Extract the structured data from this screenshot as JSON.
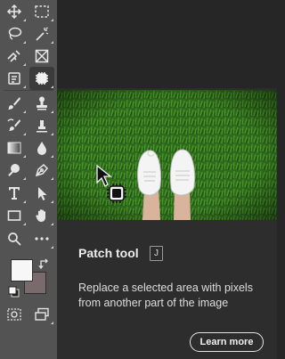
{
  "toolbar": {
    "tools": [
      {
        "name": "move-tool",
        "icon": "move-icon"
      },
      {
        "name": "rectangular-marquee-tool",
        "icon": "marquee-icon"
      },
      {
        "name": "lasso-tool",
        "icon": "lasso-icon"
      },
      {
        "name": "magic-wand-tool",
        "icon": "magic-wand-icon"
      },
      {
        "name": "crop-tool",
        "icon": "crop-icon"
      },
      {
        "name": "frame-tool",
        "icon": "frame-icon"
      },
      {
        "name": "eyedropper-tool",
        "icon": "eyedropper-icon"
      },
      {
        "name": "patch-tool",
        "icon": "patch-icon",
        "active": true
      },
      {
        "name": "brush-tool",
        "icon": "brush-icon"
      },
      {
        "name": "clone-stamp-tool",
        "icon": "stamp-icon"
      },
      {
        "name": "history-brush-tool",
        "icon": "history-brush-icon"
      },
      {
        "name": "eraser-tool",
        "icon": "eraser-icon"
      },
      {
        "name": "gradient-tool",
        "icon": "gradient-icon"
      },
      {
        "name": "blur-tool",
        "icon": "drop-icon"
      },
      {
        "name": "dodge-tool",
        "icon": "dodge-icon"
      },
      {
        "name": "pen-tool",
        "icon": "pen-icon"
      },
      {
        "name": "type-tool",
        "icon": "type-icon"
      },
      {
        "name": "path-selection-tool",
        "icon": "arrow-icon"
      },
      {
        "name": "rectangle-tool",
        "icon": "rectangle-icon"
      },
      {
        "name": "hand-tool",
        "icon": "hand-icon"
      },
      {
        "name": "zoom-tool",
        "icon": "zoom-icon"
      },
      {
        "name": "more-tools",
        "icon": "ellipsis-icon"
      }
    ],
    "foreground_color": "#f7f7f7",
    "background_color": "#7a6a6c"
  },
  "tooltip": {
    "title": "Patch tool",
    "shortcut": "J",
    "description": "Replace a selected area with pixels from another part of the image",
    "learn_more_label": "Learn more"
  }
}
